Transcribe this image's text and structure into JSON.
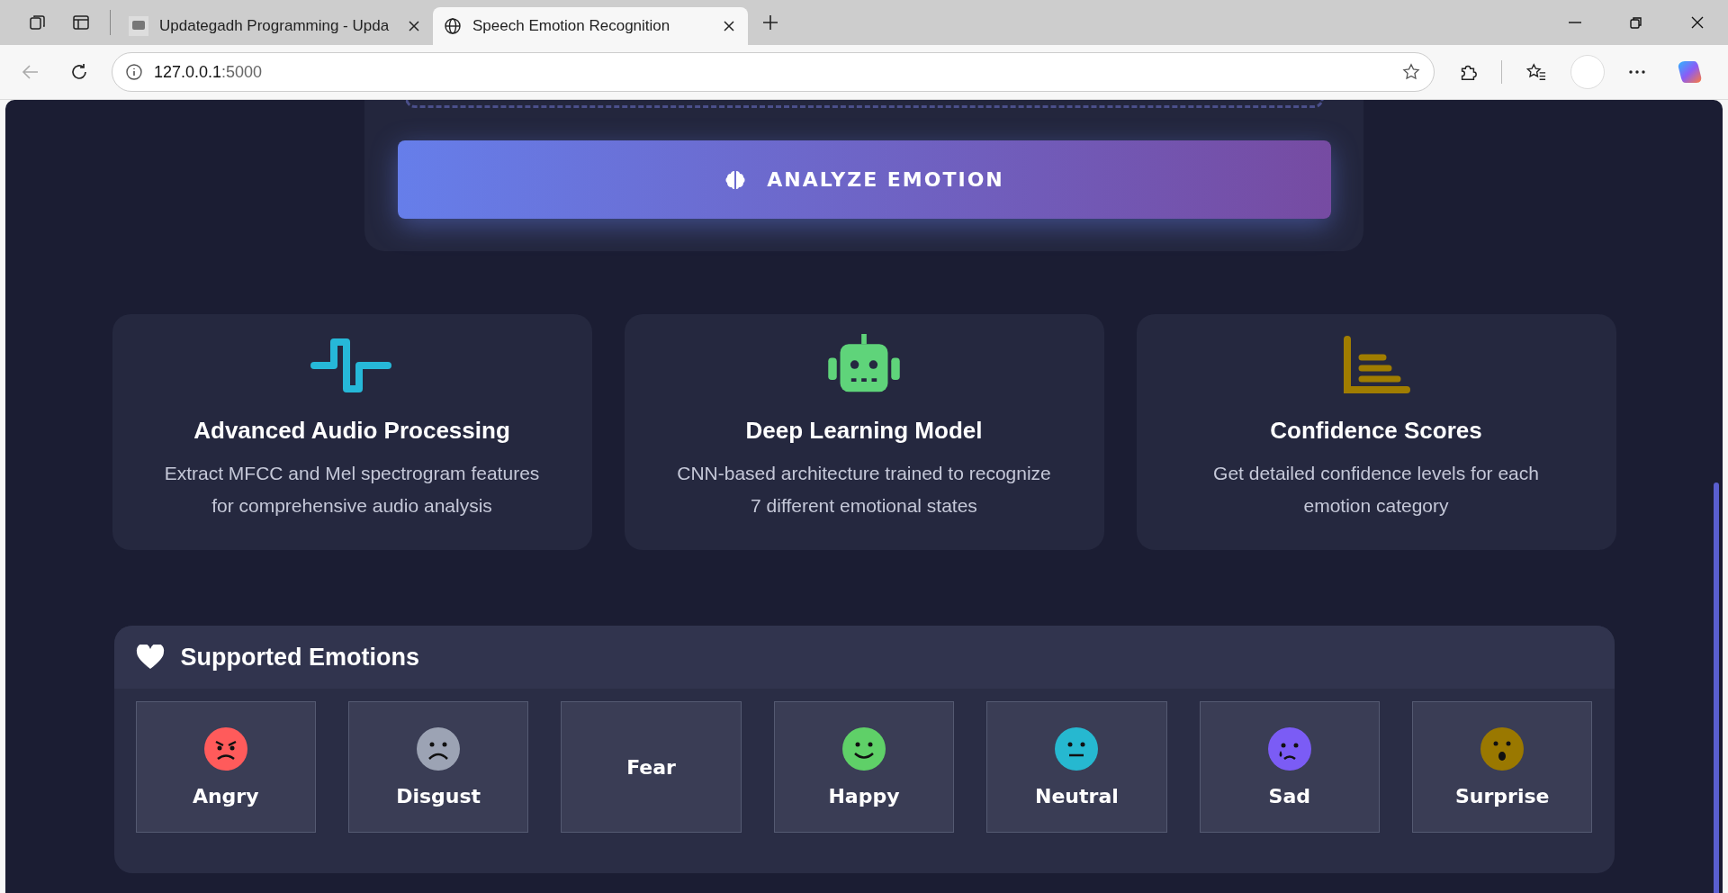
{
  "browser": {
    "tabs": [
      {
        "title": "Updategadh Programming - Upda",
        "selected": false
      },
      {
        "title": "Speech Emotion Recognition",
        "selected": true
      }
    ],
    "url_host": "127.0.0.1",
    "url_port": ":5000"
  },
  "analyze_button": {
    "label": "ANALYZE EMOTION"
  },
  "features": [
    {
      "kind": "wave",
      "title": "Advanced Audio Processing",
      "text": "Extract MFCC and Mel spectrogram features for comprehensive audio analysis"
    },
    {
      "kind": "robot",
      "title": "Deep Learning Model",
      "text": "CNN-based architecture trained to recognize 7 different emotional states"
    },
    {
      "kind": "chart",
      "title": "Confidence Scores",
      "text": "Get detailed confidence levels for each emotion category"
    }
  ],
  "emotions_panel": {
    "title": "Supported Emotions",
    "emotions": [
      {
        "label": "Angry",
        "kind": "angry",
        "color": "#ff5b5b"
      },
      {
        "label": "Disgust",
        "kind": "sad",
        "color": "#9ca3b4"
      },
      {
        "label": "Fear"
      },
      {
        "label": "Happy",
        "kind": "smile",
        "color": "#5fd068"
      },
      {
        "label": "Neutral",
        "kind": "neutral",
        "color": "#26b8d0"
      },
      {
        "label": "Sad",
        "kind": "cry",
        "color": "#7b5cf5"
      },
      {
        "label": "Surprise",
        "kind": "surprise",
        "color": "#9a7800"
      }
    ]
  }
}
